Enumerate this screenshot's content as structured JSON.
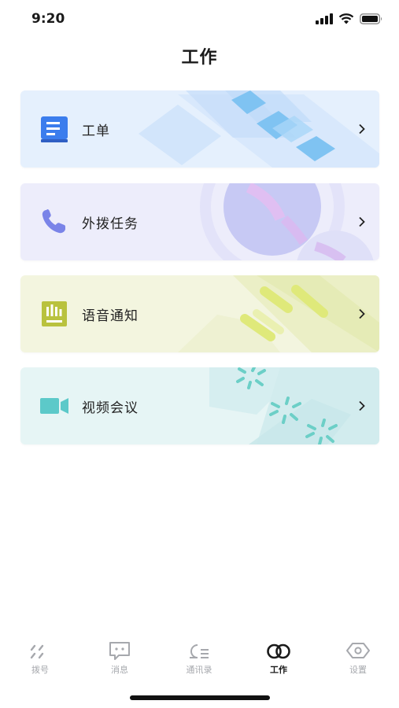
{
  "status_bar": {
    "time": "9:20"
  },
  "header": {
    "title": "工作"
  },
  "cards": [
    {
      "label": "工单",
      "icon": "work-order-icon",
      "accent": "#3b7ded"
    },
    {
      "label": "外拨任务",
      "icon": "phone-icon",
      "accent": "#7a84e8"
    },
    {
      "label": "语音通知",
      "icon": "voice-notice-icon",
      "accent": "#b9c23e"
    },
    {
      "label": "视频会议",
      "icon": "video-camera-icon",
      "accent": "#5cc9c9"
    }
  ],
  "tabbar": {
    "items": [
      {
        "label": "拨号",
        "icon": "dial-icon"
      },
      {
        "label": "消息",
        "icon": "message-icon"
      },
      {
        "label": "通讯录",
        "icon": "contacts-icon"
      },
      {
        "label": "工作",
        "icon": "work-icon",
        "active": true
      },
      {
        "label": "设置",
        "icon": "settings-icon"
      }
    ]
  }
}
